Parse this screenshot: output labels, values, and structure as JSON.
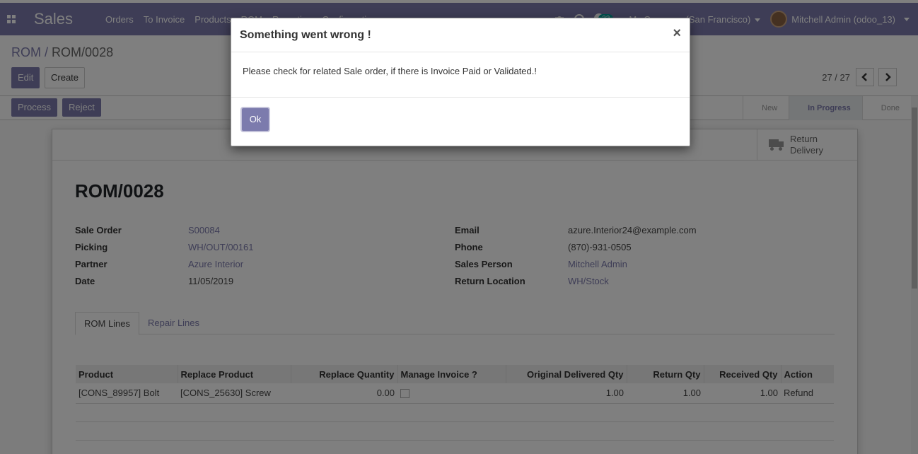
{
  "navbar": {
    "app_name": "Sales",
    "menu": [
      "Orders",
      "To Invoice",
      "Products",
      "ROM",
      "Reporting",
      "Configuration"
    ],
    "chat_count": "32",
    "company": "My Company (San Francisco)",
    "user": "Mitchell Admin (odoo_13)"
  },
  "breadcrumb": {
    "parent": "ROM",
    "separator": "/",
    "current": "ROM/0028"
  },
  "buttons": {
    "edit": "Edit",
    "create": "Create",
    "process": "Process",
    "reject": "Reject"
  },
  "pager": {
    "value": "27 / 27"
  },
  "stages": [
    "New",
    "In Progress",
    "Done"
  ],
  "active_stage": "In Progress",
  "smart_button": {
    "label_line1": "Return",
    "label_line2": "Delivery"
  },
  "record": {
    "title": "ROM/0028",
    "left_fields": [
      {
        "label": "Sale Order",
        "value": "S00084"
      },
      {
        "label": "Picking",
        "value": "WH/OUT/00161"
      },
      {
        "label": "Partner",
        "value": "Azure Interior"
      },
      {
        "label": "Date",
        "value": "11/05/2019"
      }
    ],
    "right_fields": [
      {
        "label": "Email",
        "value": "azure.Interior24@example.com"
      },
      {
        "label": "Phone",
        "value": "(870)-931-0505"
      },
      {
        "label": "Sales Person",
        "value": "Mitchell Admin"
      },
      {
        "label": "Return Location",
        "value": "WH/Stock"
      }
    ]
  },
  "tabs": [
    "ROM Lines",
    "Repair Lines"
  ],
  "table": {
    "headers": [
      "Product",
      "Replace Product",
      "Replace Quantity",
      "Manage Invoice ?",
      "Original Delivered Qty",
      "Return Qty",
      "Received Qty",
      "Action"
    ],
    "rows": [
      {
        "product": "[CONS_89957] Bolt",
        "replace_product": "[CONS_25630] Screw",
        "replace_qty": "0.00",
        "manage_invoice": false,
        "original_qty": "1.00",
        "return_qty": "1.00",
        "received_qty": "1.00",
        "action": "Refund"
      }
    ]
  },
  "dialog": {
    "title": "Something went wrong !",
    "close": "×",
    "message": "Please check for related Sale order, if there is Invoice Paid or Validated.!",
    "ok": "Ok"
  },
  "colors": {
    "brand": "#7c7bad",
    "badge": "#00a09d"
  }
}
